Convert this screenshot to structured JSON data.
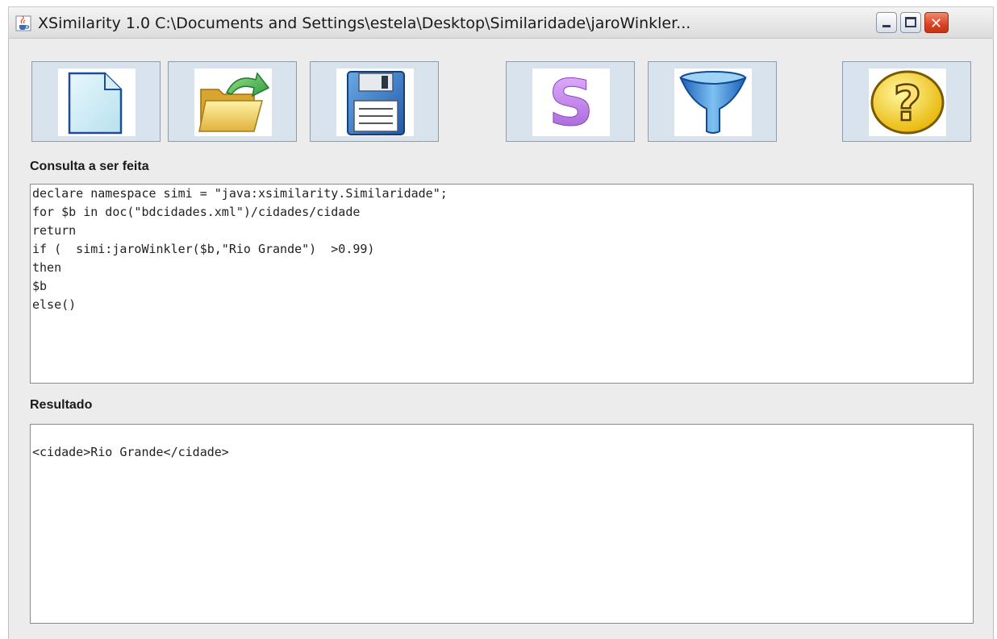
{
  "window": {
    "title": "XSimilarity 1.0 C:\\Documents and Settings\\estela\\Desktop\\Similaridade\\jaroWinkler...",
    "close_glyph": "✕"
  },
  "toolbar": {
    "buttons": [
      {
        "icon": "new-document-icon"
      },
      {
        "icon": "open-folder-icon"
      },
      {
        "icon": "save-disk-icon"
      },
      {
        "icon": "similarity-s-icon"
      },
      {
        "icon": "filter-funnel-icon"
      },
      {
        "icon": "help-question-icon"
      }
    ]
  },
  "query": {
    "label": "Consulta a ser feita",
    "lines": [
      "declare namespace simi = \"java:xsimilarity.Similaridade\";",
      "for $b in doc(\"bdcidades.xml\")/cidades/cidade",
      "return",
      "if (  simi:jaroWinkler($b,\"Rio Grande\")  >0.99)",
      "then",
      "$b",
      "else()"
    ]
  },
  "result": {
    "label": "Resultado",
    "lines": [
      "",
      "<cidade>Rio Grande</cidade>"
    ]
  },
  "colors": {
    "panel_bg": "#ececec",
    "button_bg": "#d9e3ee",
    "close_red": "#d74424"
  }
}
